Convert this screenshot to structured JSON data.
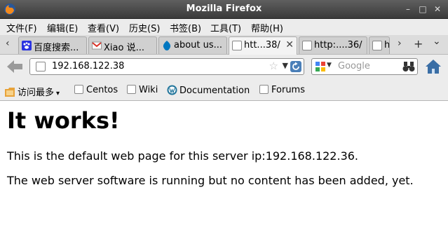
{
  "window": {
    "title": "Mozilla Firefox",
    "controls": [
      "–",
      "□",
      "✕"
    ]
  },
  "menu": [
    "文件(F)",
    "编辑(E)",
    "查看(V)",
    "历史(S)",
    "书签(B)",
    "工具(T)",
    "帮助(H)"
  ],
  "tabs": [
    {
      "label": "百度搜索...",
      "icon": "baidu-paw-icon"
    },
    {
      "label": "Xiao 说...",
      "icon": "gmail-icon"
    },
    {
      "label": "about us...",
      "icon": "drupal-icon"
    },
    {
      "label": "htt...38/",
      "icon": "page-icon",
      "active": true
    },
    {
      "label": "http:....36/",
      "icon": "page-icon"
    },
    {
      "label": "h",
      "icon": "page-icon"
    }
  ],
  "tab_nav": {
    "left": "‹",
    "right": "›",
    "add": "+",
    "list": "⌄"
  },
  "navigation": {
    "url": "192.168.122.38",
    "search_placeholder": "Google"
  },
  "bookmarks": [
    {
      "label": "访问最多",
      "icon": "folder-icon",
      "dropdown": true
    },
    {
      "label": "Centos",
      "icon": "page-icon"
    },
    {
      "label": "Wiki",
      "icon": "page-icon"
    },
    {
      "label": "Documentation",
      "icon": "wordpress-icon"
    },
    {
      "label": "Forums",
      "icon": "page-icon"
    }
  ],
  "page": {
    "heading": "It works!",
    "line1": "This is the default web page for this server ip:192.168.122.36.",
    "line2": "The web server software is running but no content has been added, yet."
  },
  "colors": {
    "titlebar": "#4a4a4a",
    "chrome": "#ececec",
    "gmail_red": "#d93025",
    "baidu_blue": "#2932e1",
    "drupal_blue": "#0077c0",
    "home_blue": "#3a6ea5"
  }
}
